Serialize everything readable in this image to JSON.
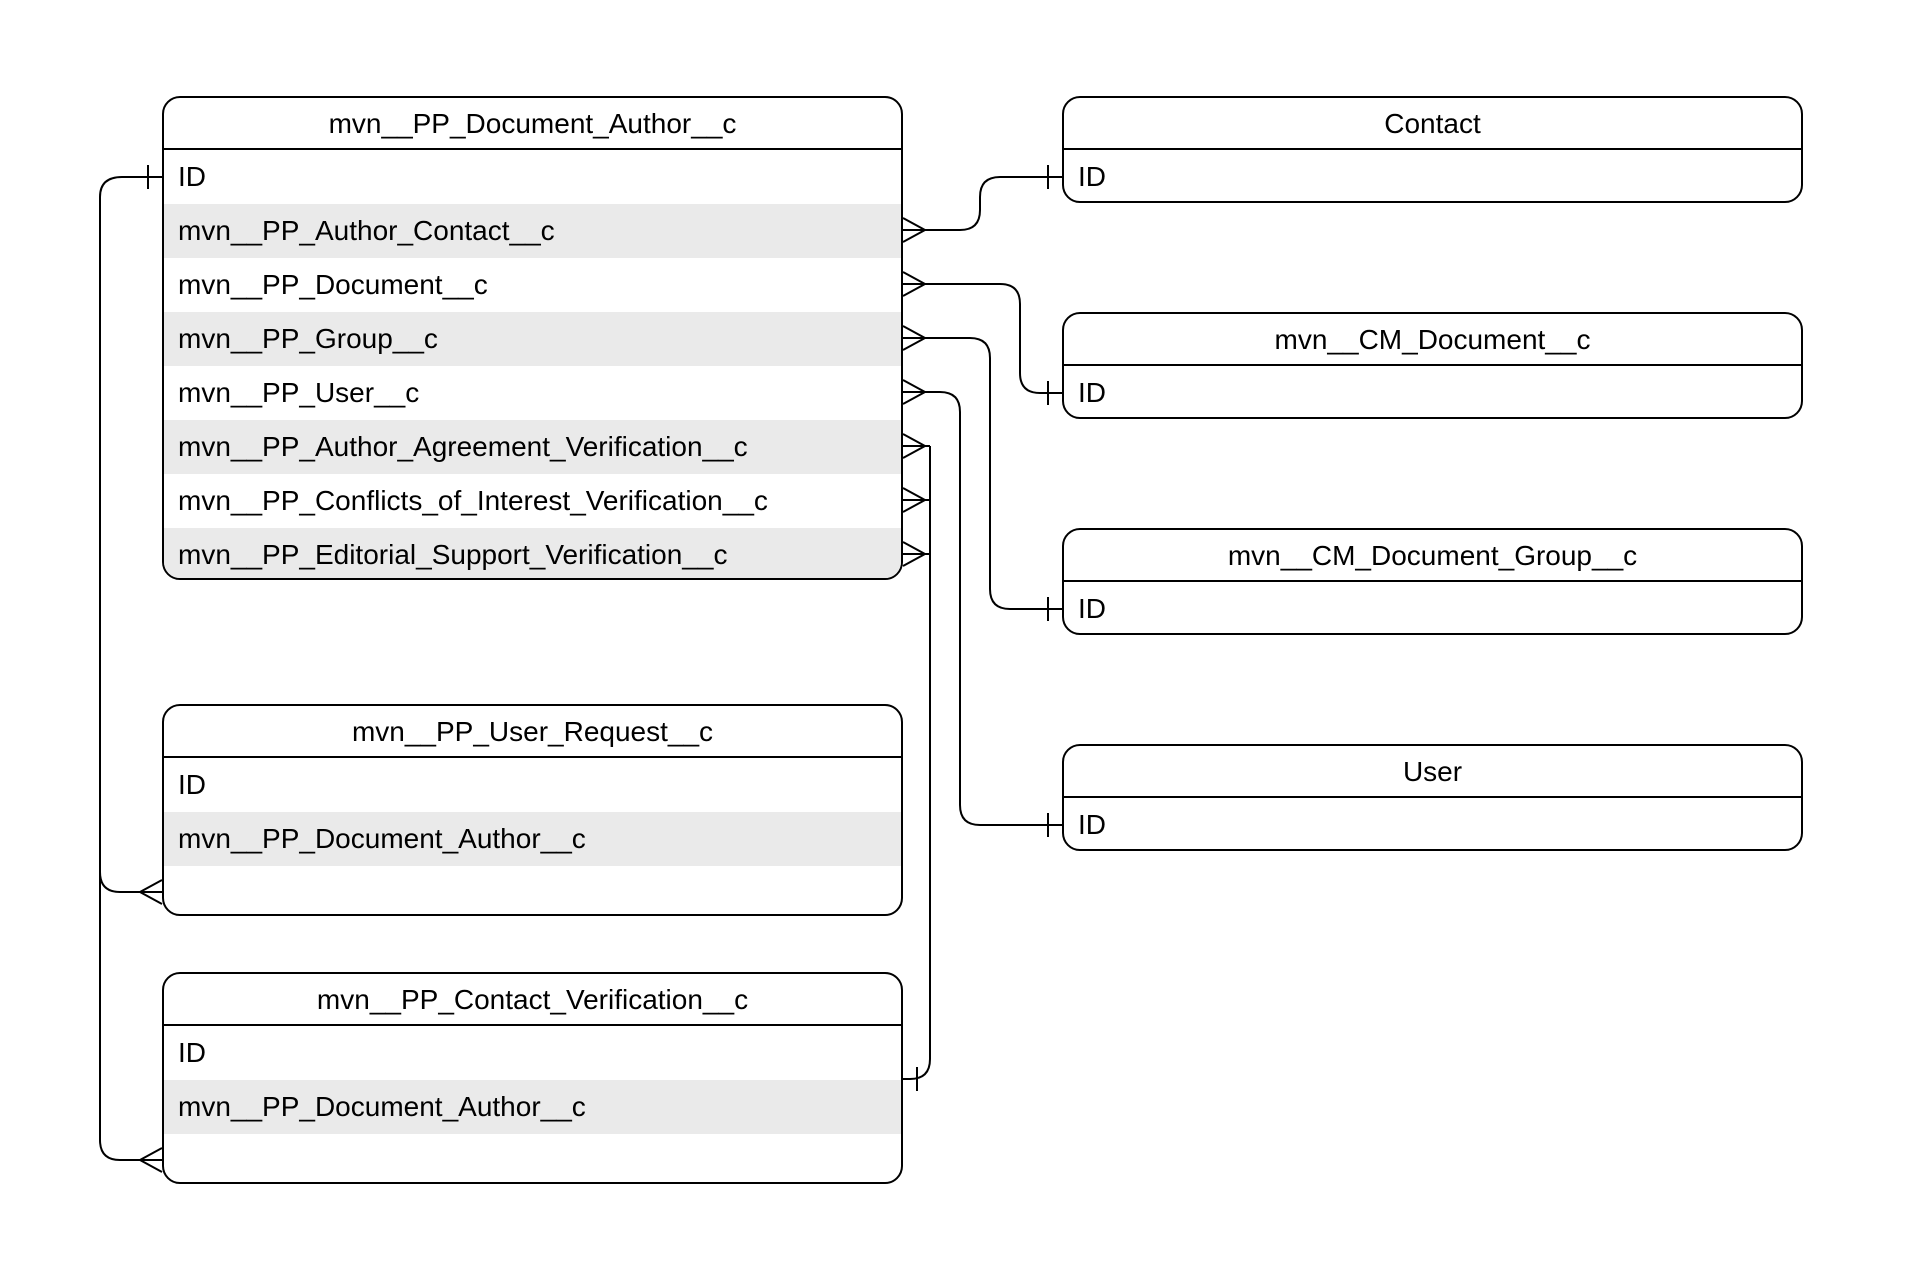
{
  "diagram": {
    "type": "entity-relationship",
    "entities": {
      "docAuthor": {
        "title": "mvn__PP_Document_Author__c",
        "fields": [
          "ID",
          "mvn__PP_Author_Contact__c",
          "mvn__PP_Document__c",
          "mvn__PP_Group__c",
          "mvn__PP_User__c",
          "mvn__PP_Author_Agreement_Verification__c",
          "mvn__PP_Conflicts_of_Interest_Verification__c",
          "mvn__PP_Editorial_Support_Verification__c"
        ]
      },
      "userRequest": {
        "title": "mvn__PP_User_Request__c",
        "fields": [
          "ID",
          "mvn__PP_Document_Author__c"
        ]
      },
      "contactVerification": {
        "title": "mvn__PP_Contact_Verification__c",
        "fields": [
          "ID",
          "mvn__PP_Document_Author__c"
        ]
      },
      "contact": {
        "title": "Contact",
        "fields": [
          "ID"
        ]
      },
      "cmDocument": {
        "title": "mvn__CM_Document__c",
        "fields": [
          "ID"
        ]
      },
      "cmDocumentGroup": {
        "title": "mvn__CM_Document_Group__c",
        "fields": [
          "ID"
        ]
      },
      "user": {
        "title": "User",
        "fields": [
          "ID"
        ]
      }
    },
    "relationships": [
      {
        "from": "docAuthor.mvn__PP_Author_Contact__c",
        "to": "contact.ID",
        "cardinality": "many-to-one"
      },
      {
        "from": "docAuthor.mvn__PP_Document__c",
        "to": "cmDocument.ID",
        "cardinality": "many-to-one"
      },
      {
        "from": "docAuthor.mvn__PP_Group__c",
        "to": "cmDocumentGroup.ID",
        "cardinality": "many-to-one"
      },
      {
        "from": "docAuthor.mvn__PP_User__c",
        "to": "user.ID",
        "cardinality": "many-to-one"
      },
      {
        "from": "docAuthor.mvn__PP_Author_Agreement_Verification__c",
        "to": "contactVerification.ID",
        "cardinality": "many-to-one"
      },
      {
        "from": "docAuthor.mvn__PP_Conflicts_of_Interest_Verification__c",
        "to": "contactVerification.ID",
        "cardinality": "many-to-one"
      },
      {
        "from": "docAuthor.mvn__PP_Editorial_Support_Verification__c",
        "to": "contactVerification.ID",
        "cardinality": "many-to-one"
      },
      {
        "from": "userRequest.mvn__PP_Document_Author__c",
        "to": "docAuthor.ID",
        "cardinality": "many-to-one"
      },
      {
        "from": "contactVerification.mvn__PP_Document_Author__c",
        "to": "docAuthor.ID",
        "cardinality": "many-to-one"
      }
    ]
  }
}
